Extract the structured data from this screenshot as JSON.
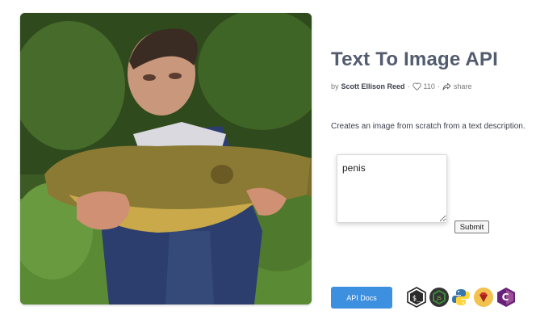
{
  "page": {
    "title": "Text To Image API",
    "byline": {
      "prefix": "by",
      "author": "Scott Ellison Reed",
      "sep1": "·",
      "likes": "110",
      "sep2": "·",
      "share": "share"
    },
    "description": "Creates an image from scratch from a text description.",
    "hero_image": {
      "alt": "generated-image-man-holding-fish"
    }
  },
  "form": {
    "prompt_value": "penis",
    "submit_label": "Submit"
  },
  "footer": {
    "api_docs_label": "API Docs",
    "languages": [
      {
        "name": "shell",
        "icon": "terminal-icon",
        "color": "#ffffff"
      },
      {
        "name": "nodejs",
        "icon": "nodejs-icon",
        "color": "#3c873a"
      },
      {
        "name": "python",
        "icon": "python-icon",
        "color": "#3776ab"
      },
      {
        "name": "ruby",
        "icon": "ruby-icon",
        "color": "#cc342d"
      },
      {
        "name": "csharp",
        "icon": "csharp-icon",
        "color": "#68217a"
      }
    ]
  }
}
